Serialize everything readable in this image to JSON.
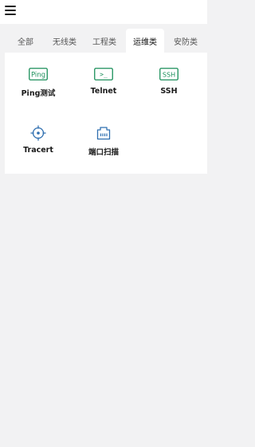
{
  "header": {
    "menu_icon": "hamburger-menu-icon"
  },
  "tabs": [
    {
      "label": "全部"
    },
    {
      "label": "无线类"
    },
    {
      "label": "工程类"
    },
    {
      "label": "运维类"
    },
    {
      "label": "安防类"
    }
  ],
  "active_tab": "运维类",
  "tools": [
    {
      "label": "Ping测试",
      "icon": "ping-icon",
      "icon_text": "Ping"
    },
    {
      "label": "Telnet",
      "icon": "terminal-icon",
      "icon_text": ">_"
    },
    {
      "label": "SSH",
      "icon": "ssh-icon",
      "icon_text": "SSH"
    },
    {
      "label": "Tracert",
      "icon": "crosshair-target-icon"
    },
    {
      "label": "端口扫描",
      "icon": "network-port-icon"
    }
  ],
  "colors": {
    "accent": "#1a8f5a",
    "icon_blue": "#2f6fb0",
    "page_bg": "#f2f2f3"
  }
}
